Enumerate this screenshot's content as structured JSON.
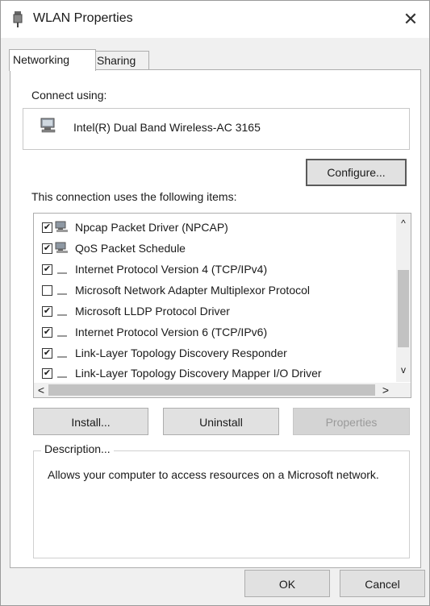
{
  "window": {
    "title": "WLAN Properties",
    "close_glyph": "✕"
  },
  "tabs": [
    {
      "label": "Networking",
      "active": true
    },
    {
      "label": "Sharing",
      "active": false
    }
  ],
  "connect": {
    "label": "Connect using:",
    "adapter": "Intel(R) Dual Band Wireless-AC 3165",
    "configure_button": "Configure..."
  },
  "items": {
    "label": "This connection uses the following items:",
    "list": [
      {
        "checked": true,
        "icon": "network-client-icon",
        "label": "Npcap Packet Driver (NPCAP)"
      },
      {
        "checked": true,
        "icon": "network-client-icon",
        "label": "QoS Packet Schedule"
      },
      {
        "checked": true,
        "icon": "protocol-icon",
        "label": "Internet Protocol Version 4 (TCP/IPv4)"
      },
      {
        "checked": false,
        "icon": "protocol-icon",
        "label": "Microsoft Network Adapter Multiplexor Protocol"
      },
      {
        "checked": true,
        "icon": "protocol-icon",
        "label": "Microsoft  LLDP Protocol Driver"
      },
      {
        "checked": true,
        "icon": "protocol-icon",
        "label": "Internet Protocol Version 6 (TCP/IPv6)"
      },
      {
        "checked": true,
        "icon": "protocol-icon",
        "label": "Link-Layer Topology Discovery Responder"
      },
      {
        "checked": true,
        "icon": "protocol-icon",
        "label": "Link-Layer Topology Discovery Mapper I/O Driver"
      }
    ],
    "check_glyph": "✔",
    "scroll_up": "^",
    "scroll_down": "v",
    "scroll_left": "<",
    "scroll_right": ">"
  },
  "buttons": {
    "install": "Install...",
    "uninstall": "Uninstall",
    "properties": "Properties",
    "ok": "OK",
    "cancel": "Cancel"
  },
  "description": {
    "legend": "Description...",
    "text": "Allows your computer to access resources on a Microsoft network."
  }
}
